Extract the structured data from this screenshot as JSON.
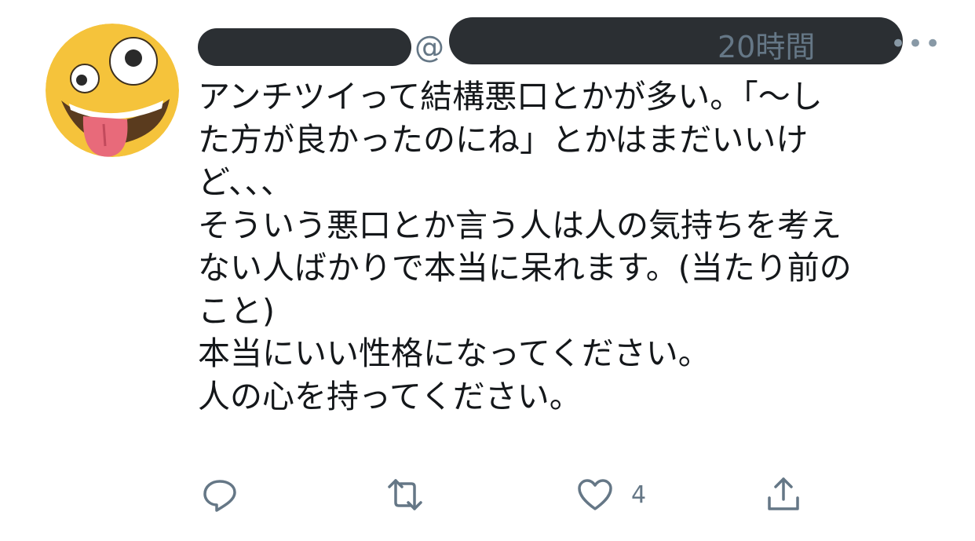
{
  "tweet": {
    "avatar_icon": "zany-face-emoji-icon",
    "author": {
      "at_symbol": "@",
      "time": "20時間",
      "menu_icon": "more-icon",
      "menu_glyph": "•••"
    },
    "text_lines": [
      "アンチツイって結構悪口とかが多い。「〜し",
      "た方が良かったのにね」とかはまだいいけ",
      "ど、、、",
      "そういう悪口とか言う人は人の気持ちを考え",
      "ない人ばかりで本当に呆れます。(当たり前の",
      "こと)",
      "本当にいい性格になってください。",
      "人の心を持ってください。"
    ],
    "actions": {
      "reply": {
        "icon": "reply-icon"
      },
      "retweet": {
        "icon": "retweet-icon"
      },
      "like": {
        "icon": "heart-icon",
        "count": "4"
      },
      "share": {
        "icon": "share-icon"
      }
    },
    "colors": {
      "text": "#14171a",
      "secondary": "#657786",
      "icon": "#657786",
      "redaction": "#2b2f33",
      "avatar_face": "#f5c33b"
    }
  }
}
